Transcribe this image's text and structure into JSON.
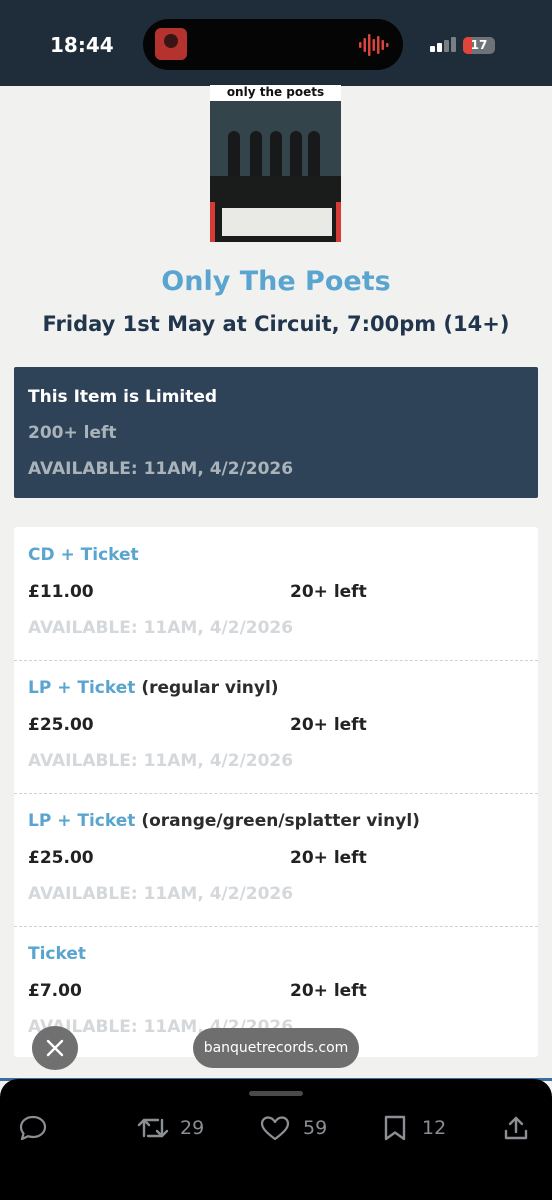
{
  "status_bar": {
    "time": "18:44",
    "battery": "17"
  },
  "poster": {
    "title": "only the poets"
  },
  "event": {
    "artist": "Only The Poets",
    "details": "Friday 1st May at Circuit, 7:00pm (14+)"
  },
  "limited_box": {
    "title": "This Item is Limited",
    "remaining": "200+ left",
    "available": "AVAILABLE: 11AM, 4/2/2026"
  },
  "items": [
    {
      "name": "CD + Ticket",
      "variant": "",
      "price": "£11.00",
      "stock": "20+ left",
      "available": "AVAILABLE: 11AM, 4/2/2026"
    },
    {
      "name": "LP + Ticket",
      "variant": "(regular vinyl)",
      "price": "£25.00",
      "stock": "20+ left",
      "available": "AVAILABLE: 11AM, 4/2/2026"
    },
    {
      "name": "LP + Ticket",
      "variant": "(orange/green/splatter vinyl)",
      "price": "£25.00",
      "stock": "20+ left",
      "available": "AVAILABLE: 11AM, 4/2/2026"
    },
    {
      "name": "Ticket",
      "variant": "",
      "price": "£7.00",
      "stock": "20+ left",
      "available": "AVAILABLE: 11AM, 4/2/2026"
    }
  ],
  "browser": {
    "url": "banquetrecords.com"
  },
  "actions": {
    "retweets": "29",
    "likes": "59",
    "bookmarks": "12"
  },
  "colors": {
    "accent": "#5aa5cf",
    "header": "#2e4358",
    "title_dark": "#21364d"
  },
  "icons": [
    "reply-icon",
    "retweet-icon",
    "heart-icon",
    "bookmark-icon",
    "share-icon",
    "close-icon"
  ]
}
